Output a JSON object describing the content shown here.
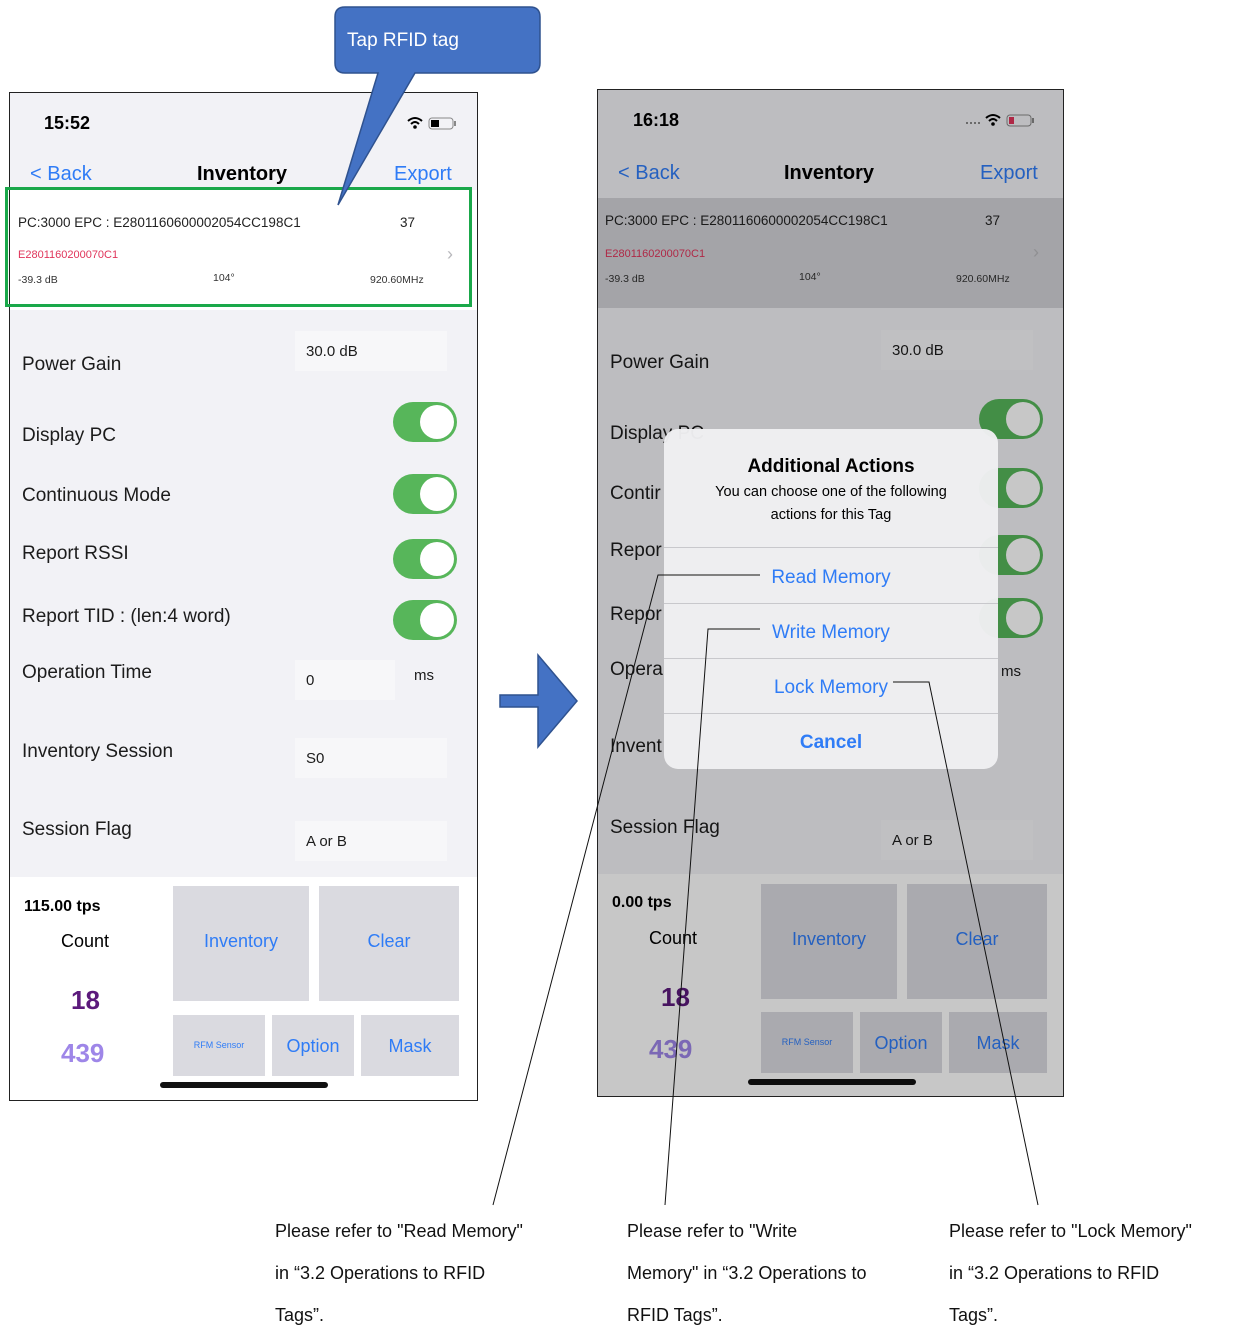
{
  "callout": {
    "text": "Tap RFID tag"
  },
  "left": {
    "status_time": "15:52",
    "nav": {
      "back": "< Back",
      "title": "Inventory",
      "export": "Export"
    },
    "tag": {
      "epc": "PC:3000 EPC : E2801160600002054CC198C1",
      "count": "37",
      "tid": "E2801160200070C1",
      "rssi": "-39.3 dB",
      "phase": "104°",
      "freq": "920.60MHz"
    },
    "settings": {
      "power_gain_label": "Power Gain",
      "power_gain_value": "30.0 dB",
      "display_pc": "Display PC",
      "continuous_mode": "Continuous Mode",
      "report_rssi": "Report RSSI",
      "report_tid": "Report TID : (len:4 word)",
      "operation_time_label": "Operation Time",
      "operation_time_value": "0",
      "operation_time_unit": "ms",
      "inventory_session_label": "Inventory Session",
      "inventory_session_value": "S0",
      "session_flag_label": "Session Flag",
      "session_flag_value": "A or B"
    },
    "stats": {
      "tps": "115.00 tps",
      "count_label": "Count",
      "count_unique": "18",
      "count_total": "439"
    },
    "buttons": {
      "inventory": "Inventory",
      "clear": "Clear",
      "rfm_sensor": "RFM Sensor",
      "option": "Option",
      "mask": "Mask"
    }
  },
  "right": {
    "status_time": "16:18",
    "nav": {
      "back": "< Back",
      "title": "Inventory",
      "export": "Export"
    },
    "tag": {
      "epc": "PC:3000 EPC : E2801160600002054CC198C1",
      "count": "37",
      "tid": "E2801160200070C1",
      "rssi": "-39.3 dB",
      "phase": "104°",
      "freq": "920.60MHz"
    },
    "settings": {
      "power_gain_label": "Power Gain",
      "power_gain_value": "30.0 dB",
      "display_pc_partial": "Display PC",
      "continuous_partial": "Contir",
      "report_partial_1": "Repor",
      "report_partial_2": "Repor",
      "operation_partial": "Opera",
      "operation_time_unit": "ms",
      "inventory_partial": "Invent",
      "session_flag_label": "Session Flag",
      "session_flag_value": "A or B"
    },
    "stats": {
      "tps": "0.00 tps",
      "count_label": "Count",
      "count_unique": "18",
      "count_total": "439"
    },
    "buttons": {
      "inventory": "Inventory",
      "clear": "Clear",
      "rfm_sensor": "RFM Sensor",
      "option": "Option",
      "mask": "Mask"
    },
    "dialog": {
      "title": "Additional Actions",
      "message_line1": "You can choose one of the following",
      "message_line2": "actions for this Tag",
      "read_memory": "Read Memory",
      "write_memory": "Write Memory",
      "lock_memory": "Lock Memory",
      "cancel": "Cancel"
    }
  },
  "notes": {
    "read": [
      "Please refer to \"Read Memory\"",
      "in “3.2 Operations to RFID",
      "Tags”."
    ],
    "write": [
      "Please refer to \"Write",
      "Memory\" in “3.2 Operations to",
      "RFID Tags”."
    ],
    "lock": [
      "Please refer to \"Lock Memory\"",
      "in “3.2 Operations to RFID",
      "Tags”."
    ]
  },
  "colors": {
    "accent_blue": "#2f7cf6",
    "toggle_green": "#57b65a",
    "highlight_green": "#1aa84a",
    "callout_blue": "#4472c4",
    "tid_pink": "#e0345a"
  }
}
